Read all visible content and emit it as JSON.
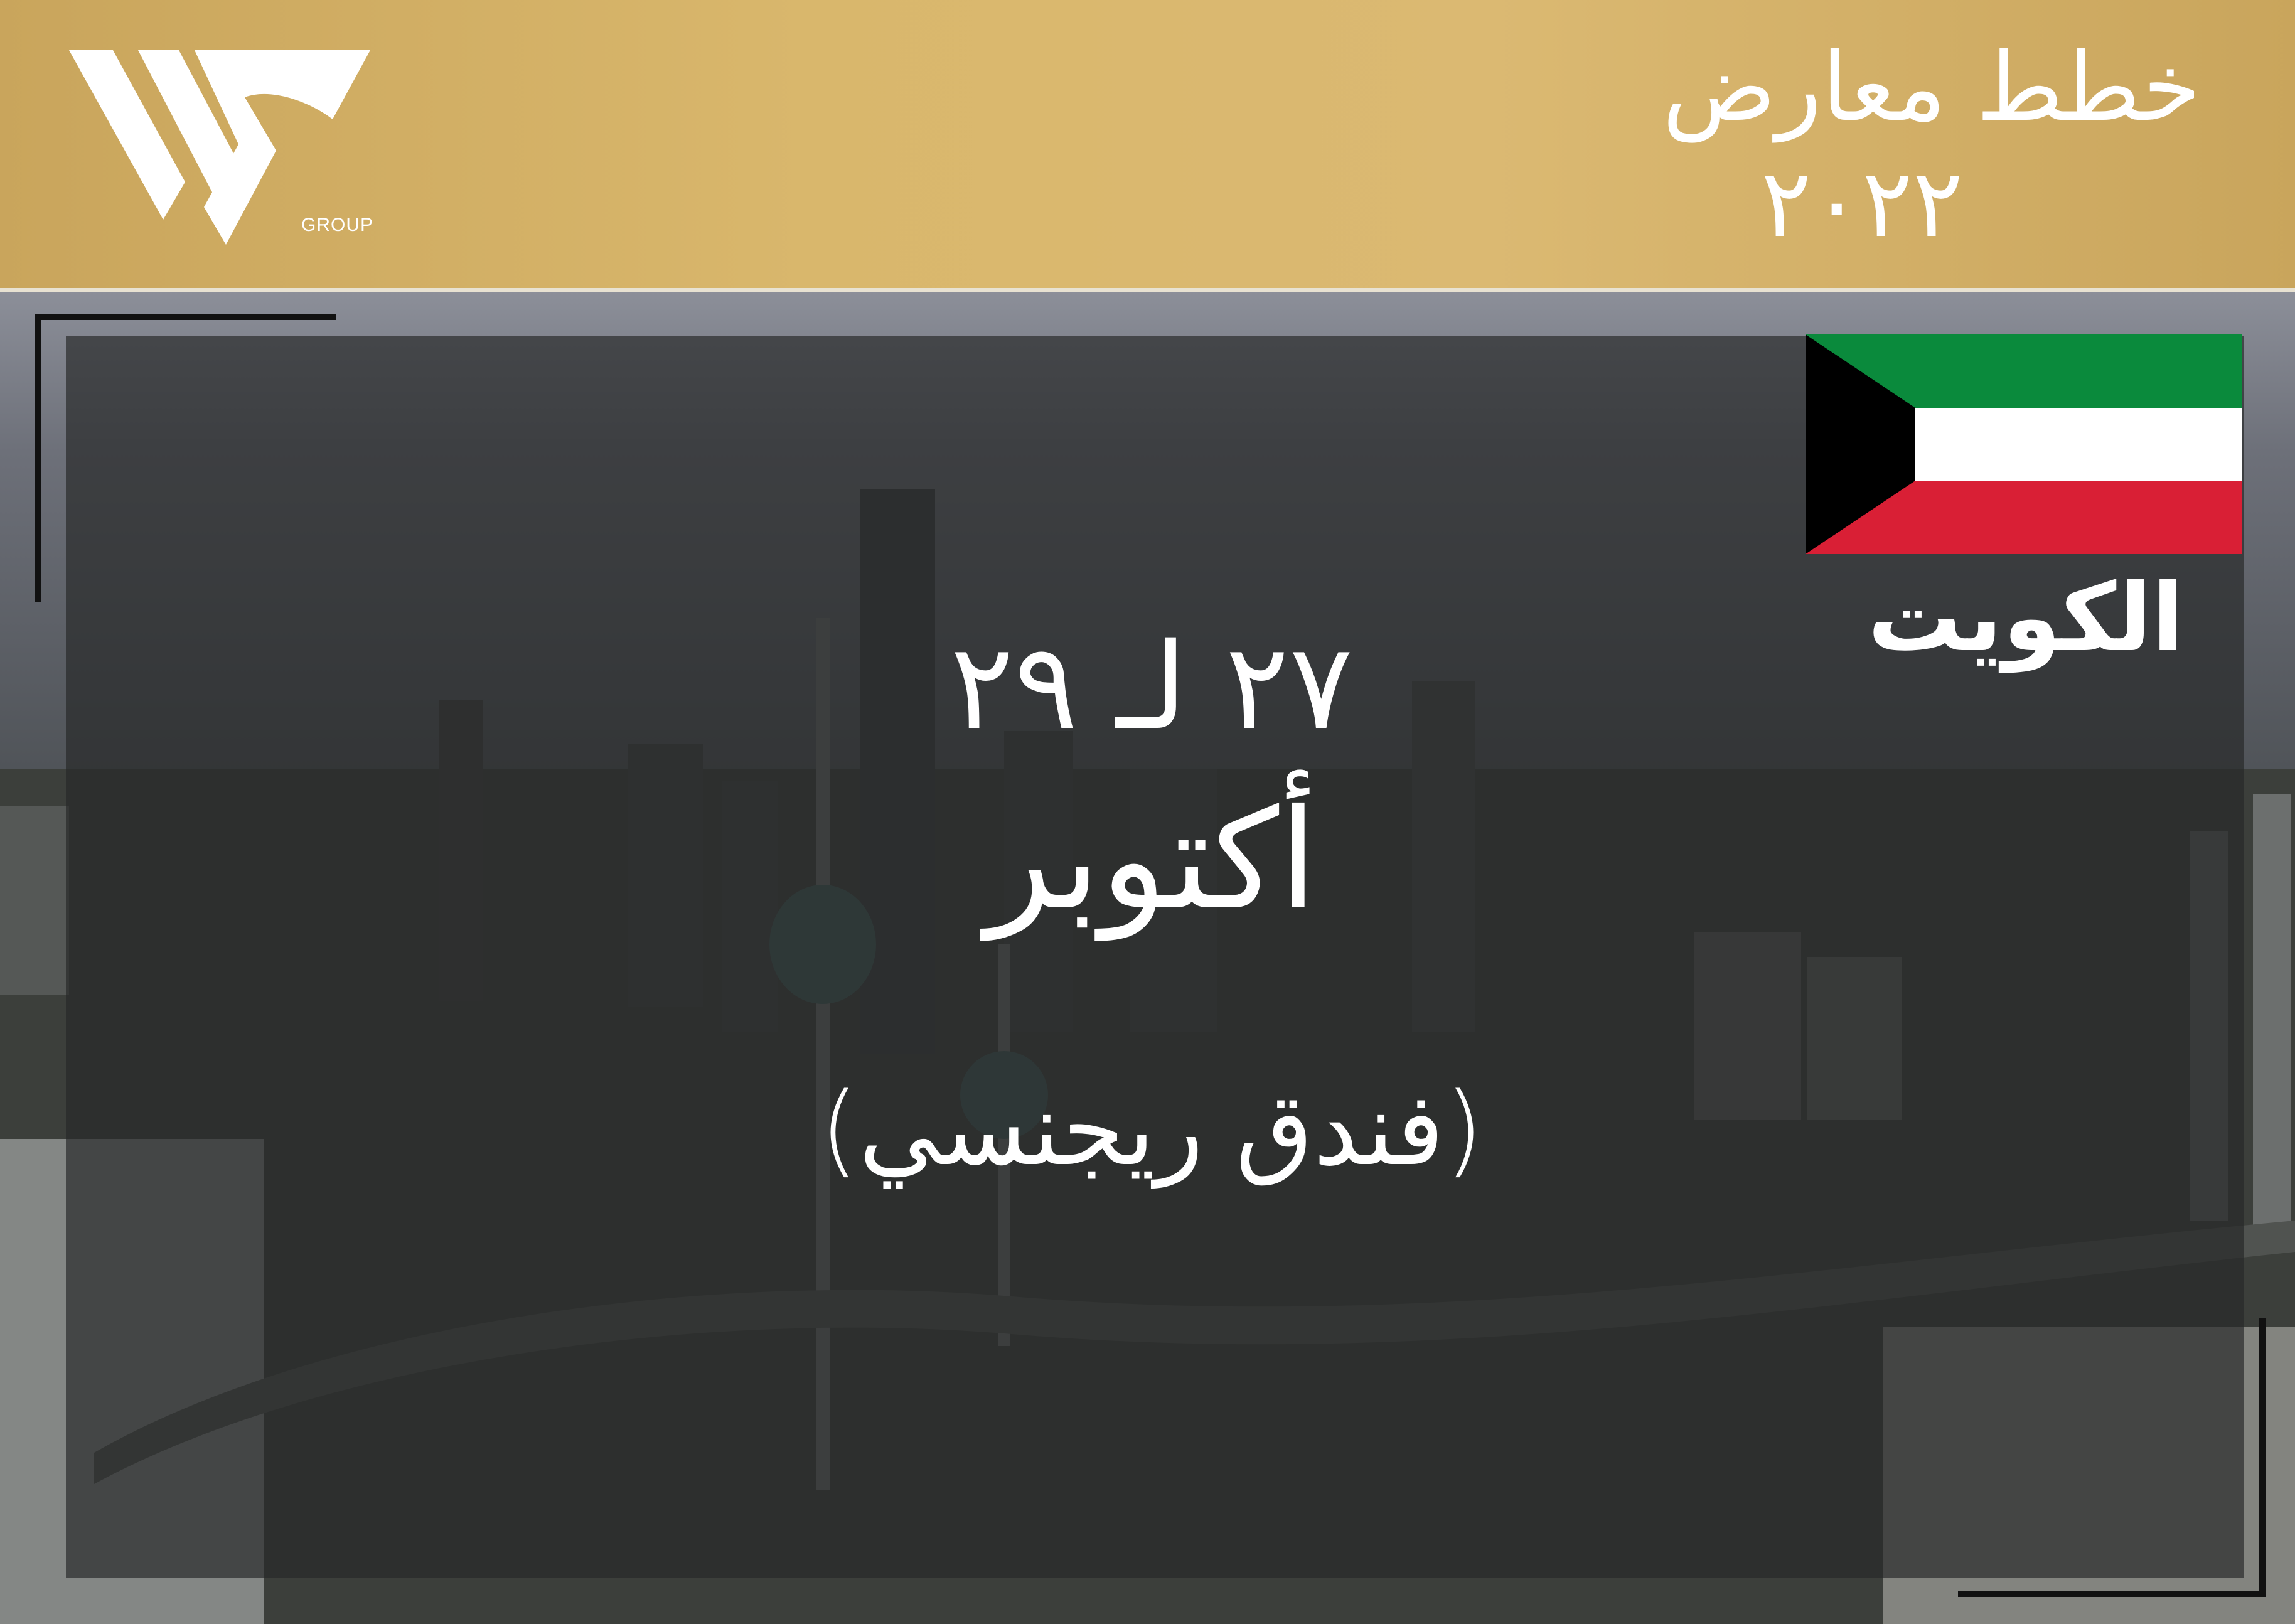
{
  "header": {
    "title": "خطط معارض",
    "year": "٢٠٢٢",
    "logo": {
      "icon": "ws-group-logo-icon",
      "caption": "GROUP"
    }
  },
  "card": {
    "flag_icon": "kuwait-flag-icon",
    "country": "الكويت",
    "dates": "٢٧ لـ ٢٩",
    "month": "أكتوبر",
    "venue": "(فندق ريجنسي)"
  },
  "colors": {
    "header_gold": "#d9b76c",
    "flag_green": "#0a8a3c",
    "flag_white": "#ffffff",
    "flag_red": "#d91f35",
    "flag_black": "#000000",
    "overlay": "#262828",
    "text": "#ffffff"
  }
}
